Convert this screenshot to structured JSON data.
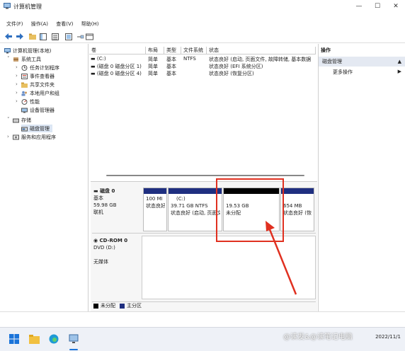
{
  "window": {
    "title": "计算机管理",
    "menu": [
      "文件(F)",
      "操作(A)",
      "查看(V)",
      "帮助(H)"
    ]
  },
  "tree": {
    "root": "计算机管理(本地)",
    "system_tools": "系统工具",
    "task_scheduler": "任务计划程序",
    "event_viewer": "事件查看器",
    "shared_folders": "共享文件夹",
    "local_users": "本地用户和组",
    "performance": "性能",
    "device_manager": "设备管理器",
    "storage": "存储",
    "disk_management": "磁盘管理",
    "services": "服务和应用程序"
  },
  "volume_list": {
    "headers": [
      "卷",
      "布局",
      "类型",
      "文件系统",
      "状态"
    ],
    "rows": [
      {
        "volume": "(C:)",
        "layout": "简单",
        "type": "基本",
        "fs": "NTFS",
        "status": "状态良好 (启动, 页面文件, 故障转储, 基本数据"
      },
      {
        "volume": "(磁盘 0 磁盘分区 1)",
        "layout": "简单",
        "type": "基本",
        "fs": "",
        "status": "状态良好 (EFI 系统分区)"
      },
      {
        "volume": "(磁盘 0 磁盘分区 4)",
        "layout": "简单",
        "type": "基本",
        "fs": "",
        "status": "状态良好 (恢复分区)"
      }
    ]
  },
  "disk0": {
    "name": "磁盘 0",
    "type": "基本",
    "size": "59.98 GB",
    "state": "联机",
    "partitions": [
      {
        "line1": "100 MI",
        "line2": "状态良好",
        "line3": ""
      },
      {
        "line1": "(C:)",
        "line2": "39.71 GB NTFS",
        "line3": "状态良好 (启动, 页面文"
      },
      {
        "line1": "",
        "line2": "19.53 GB",
        "line3": "未分配"
      },
      {
        "line1": "",
        "line2": "654 MB",
        "line3": "状态良好 (恢"
      }
    ]
  },
  "cdrom0": {
    "name": "CD-ROM 0",
    "drive": "DVD (D:)",
    "media": "无媒体"
  },
  "legend": {
    "unallocated": "未分配",
    "primary": "主分区"
  },
  "actions": {
    "header": "操作",
    "section": "磁盘管理",
    "more": "更多操作"
  },
  "taskbar": {
    "time": "",
    "date": "2022/11/1"
  },
  "watermark": "@读发&@读笔记电脑",
  "colors": {
    "primary_partition": "#1f2f80",
    "unallocated": "#000000",
    "highlight_box": "#e03020"
  }
}
